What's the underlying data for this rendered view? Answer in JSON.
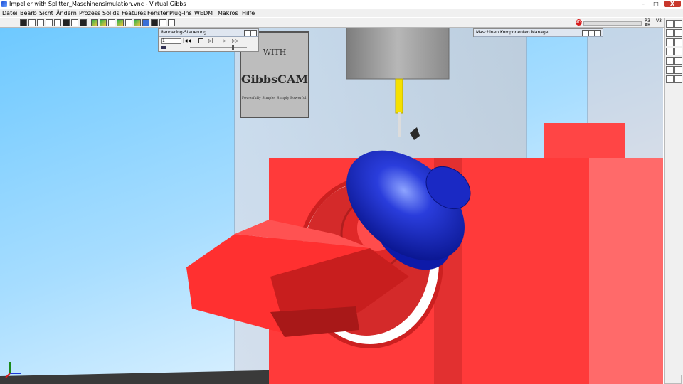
{
  "window": {
    "title": "Impeller with Splitter_Maschinensimulation.vnc - Virtual Gibbs",
    "min_label": "–",
    "max_label": "□",
    "close_label": "X"
  },
  "menu": [
    "Datei",
    "Bearb",
    "Sicht",
    "Ändern",
    "Prozess",
    "Solids",
    "Features",
    "Fenster",
    "Plug-Ins",
    "WEDM",
    "Makros",
    "Hilfe"
  ],
  "toolbar": {
    "stop_label": "STOP",
    "r_label_top": "R3",
    "r_label_bottom": "AR",
    "v_label": "V3"
  },
  "rendering_panel": {
    "title": "Rendering-Steuerung",
    "frame_value": "1"
  },
  "machine_panel": {
    "title": "Maschinen Komponenten Manager"
  },
  "sign": {
    "line1": "WITH",
    "line2": "GibbsCAM",
    "line3": "Powerfully Simple. Simply Powerful."
  },
  "colors": {
    "machine_red": "#ff3a3a",
    "spindle_grey": "#8f8f8f",
    "tool_yellow": "#f5e000",
    "part_blue": "#1424c8",
    "sky": "#8fd3ff"
  }
}
